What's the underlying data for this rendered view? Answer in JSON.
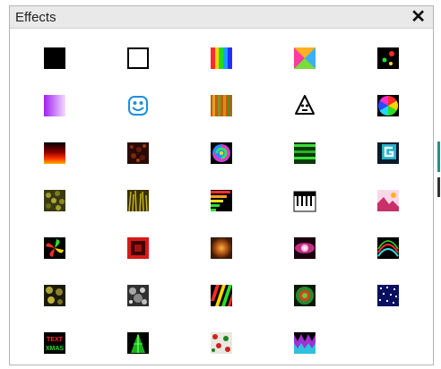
{
  "window": {
    "title": "Effects",
    "close_label": "✕"
  },
  "effects": [
    [
      "black-square-icon",
      "white-square-icon",
      "rgb-bars-icon",
      "gradient-x-icon",
      "dots-icon"
    ],
    [
      "purple-gradient-icon",
      "smiley-face-icon",
      "orange-stripes-icon",
      "ghost-face-icon",
      "color-wheel-icon"
    ],
    [
      "fire-gradient-icon",
      "red-noise-icon",
      "spiral-icon",
      "green-lines-icon",
      "letter-g-icon"
    ],
    [
      "yellow-noise-icon",
      "yellow-grass-icon",
      "equalizer-icon",
      "piano-keys-icon",
      "landscape-icon"
    ],
    [
      "pinwheel-icon",
      "red-square-ring-icon",
      "orange-cloud-icon",
      "pink-eye-icon",
      "color-waves-icon"
    ],
    [
      "yellow-blobs-icon",
      "gray-noise-icon",
      "diagonal-stripes-icon",
      "green-circle-icon",
      "starfield-icon"
    ],
    [
      "text-effect-icon",
      "green-tree-icon",
      "flower-pattern-icon",
      "zigzag-icon"
    ]
  ],
  "text_tile": {
    "line1": "TEXT",
    "line2": "XMAS"
  }
}
